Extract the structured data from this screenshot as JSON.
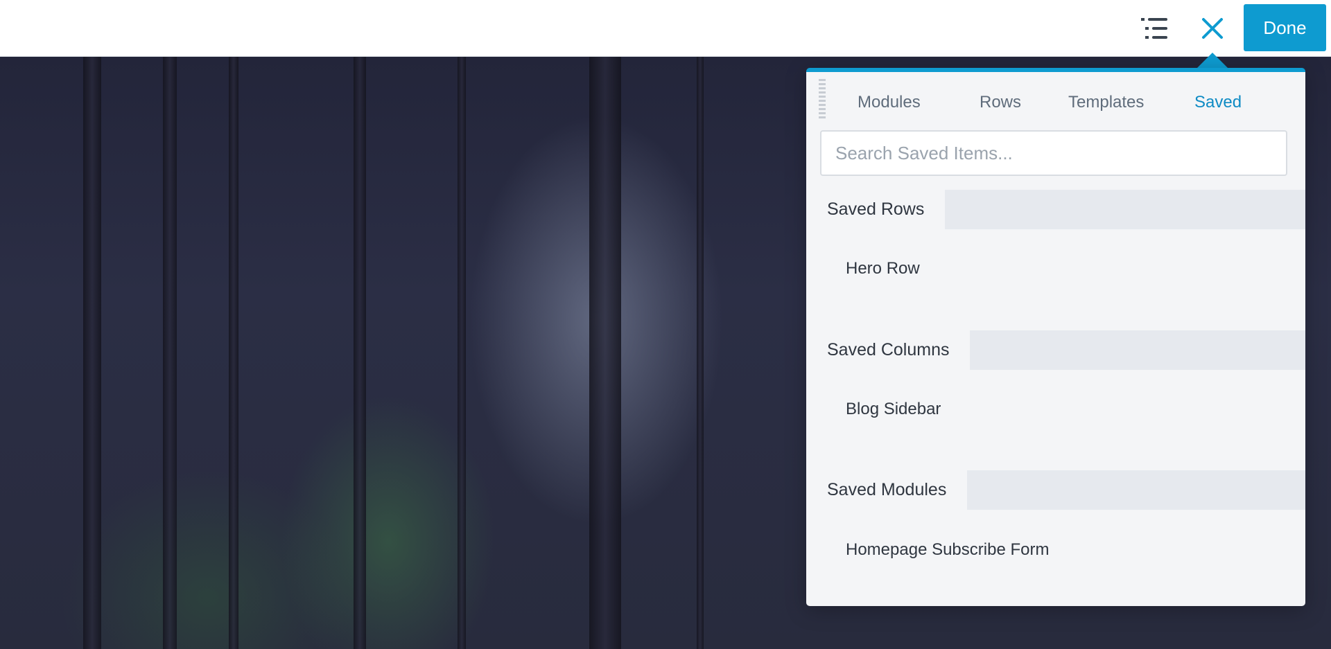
{
  "toolbar": {
    "done_label": "Done",
    "outline_icon": "outline-list-icon",
    "close_icon": "close-icon",
    "accent_color": "#0e9bd0"
  },
  "panel": {
    "tabs": [
      {
        "label": "Modules",
        "active": false
      },
      {
        "label": "Rows",
        "active": false
      },
      {
        "label": "Templates",
        "active": false
      },
      {
        "label": "Saved",
        "active": true
      }
    ],
    "search": {
      "placeholder": "Search Saved Items...",
      "value": ""
    },
    "sections": [
      {
        "title": "Saved Rows",
        "items": [
          "Hero Row"
        ]
      },
      {
        "title": "Saved Columns",
        "items": [
          "Blog Sidebar"
        ]
      },
      {
        "title": "Saved Modules",
        "items": [
          "Homepage Subscribe Form"
        ]
      }
    ]
  }
}
